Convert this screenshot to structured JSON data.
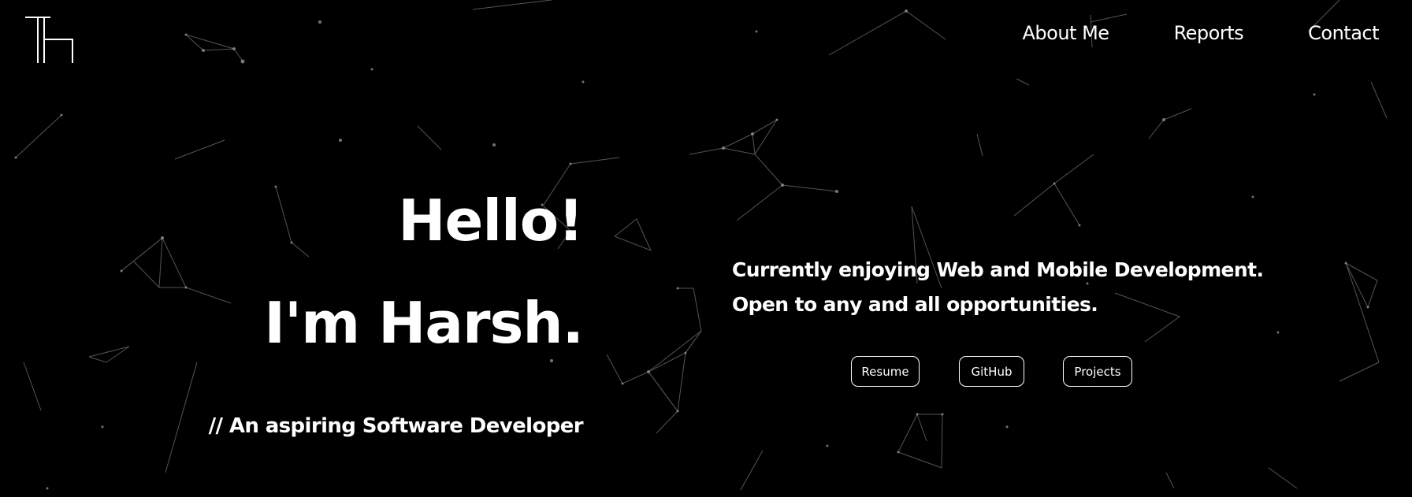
{
  "header": {
    "logo_icon": "th-monogram-logo-icon",
    "nav": [
      {
        "label": "About Me"
      },
      {
        "label": "Reports"
      },
      {
        "label": "Contact"
      }
    ]
  },
  "hero": {
    "greeting": "Hello!",
    "name_line": "I'm Harsh.",
    "tagline": "// An aspiring Software Developer"
  },
  "intro": {
    "line1": "Currently enjoying Web and Mobile Development.",
    "line2": "Open to any and all opportunities."
  },
  "buttons": {
    "resume": "Resume",
    "github": "GitHub",
    "projects": "Projects"
  },
  "theme": {
    "background": "#000000",
    "foreground": "#ffffff",
    "particle_color": "#8a8a8a"
  }
}
